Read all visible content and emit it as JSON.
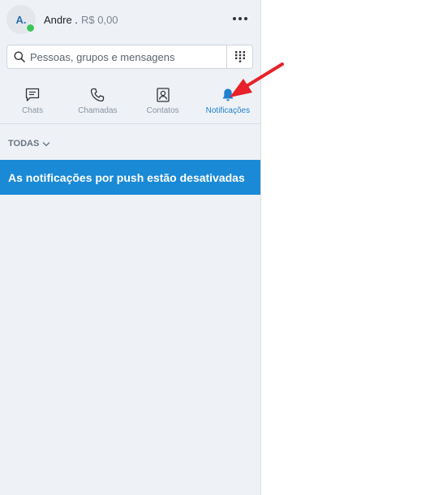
{
  "profile": {
    "initials": "A.",
    "name": "Andre .",
    "credit": "R$ 0,00",
    "status_color": "#3ec55a"
  },
  "search": {
    "placeholder": "Pessoas, grupos e mensagens",
    "value": ""
  },
  "tabs": [
    {
      "label": "Chats",
      "icon": "chat-icon",
      "active": false
    },
    {
      "label": "Chamadas",
      "icon": "phone-icon",
      "active": false
    },
    {
      "label": "Contatos",
      "icon": "contacts-icon",
      "active": false
    },
    {
      "label": "Notificações",
      "icon": "bell-icon",
      "active": true
    }
  ],
  "filter": {
    "label": "TODAS"
  },
  "banner": {
    "text": "As notificações por push estão desativadas"
  },
  "colors": {
    "accent": "#1e7fce",
    "banner": "#1a8ad6",
    "sidebar_bg": "#eef2f7",
    "annotation_arrow": "#e8212a"
  }
}
